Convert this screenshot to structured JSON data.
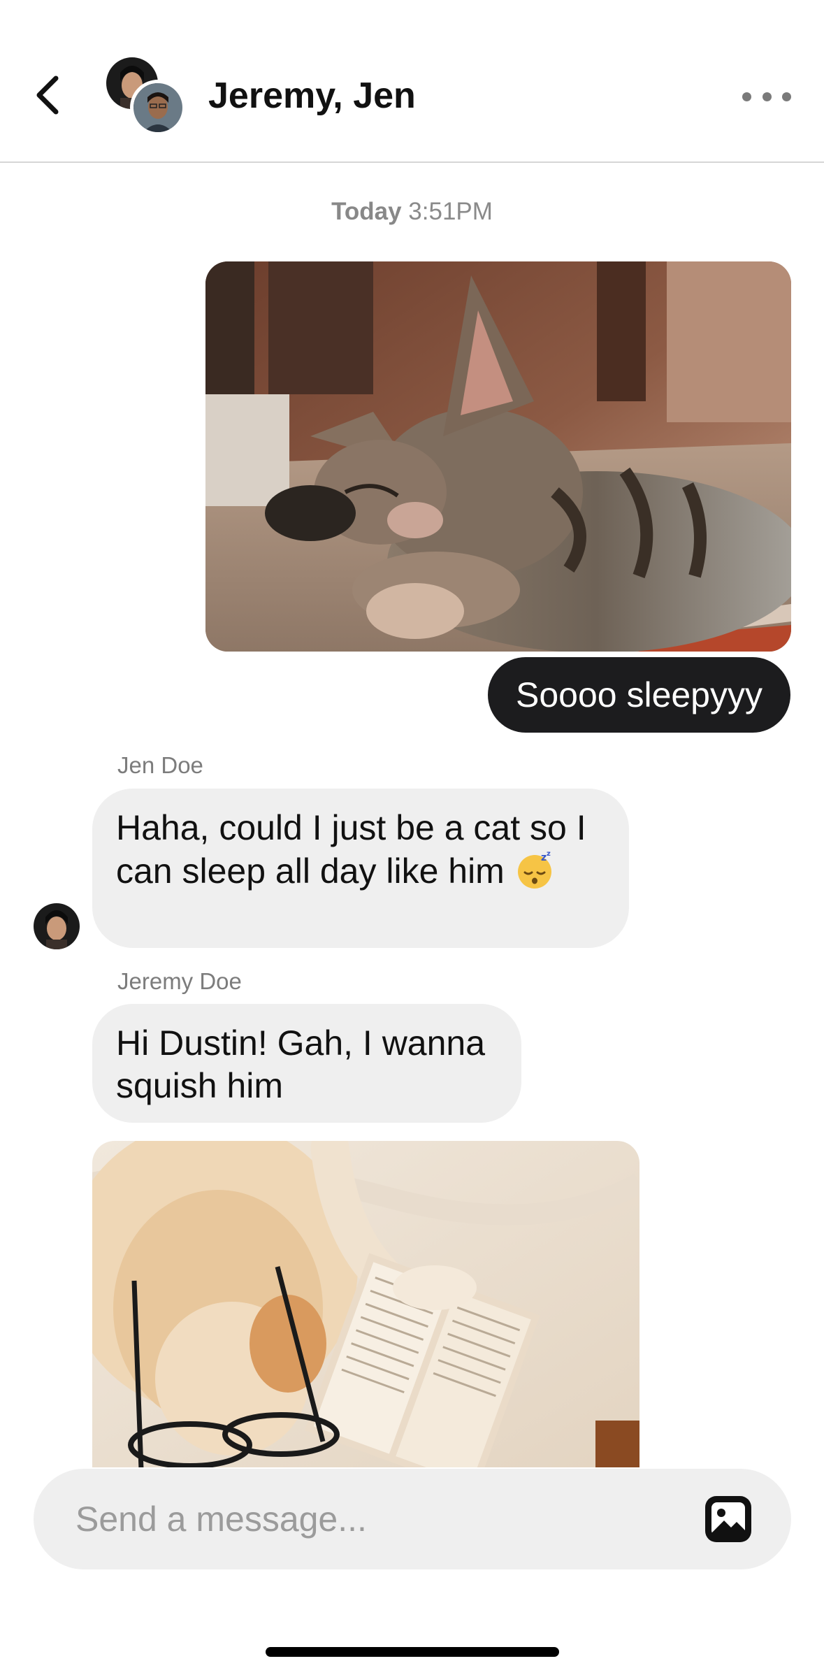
{
  "header": {
    "title": "Jeremy, Jen",
    "back_icon": "chevron-left-icon",
    "more_icon": "ellipsis-icon"
  },
  "conversation": {
    "timestamp": {
      "day": "Today",
      "time": "3:51PM"
    },
    "messages": [
      {
        "type": "photo",
        "direction": "outgoing",
        "subject": "sleeping kitten"
      },
      {
        "type": "text",
        "direction": "outgoing",
        "text": "Soooo sleepyyy"
      },
      {
        "type": "text",
        "direction": "incoming",
        "sender": "Jen Doe",
        "text": "Haha, could I just be a cat so I can sleep all day like him",
        "emoji": "sleeping-face-icon"
      },
      {
        "type": "text",
        "direction": "incoming",
        "sender": "Jeremy Doe",
        "text": "Hi Dustin! Gah, I wanna squish him"
      },
      {
        "type": "photo",
        "direction": "incoming",
        "subject": "dog sleeping with glasses and book"
      }
    ]
  },
  "composer": {
    "placeholder": "Send a message...",
    "image_icon": "image-icon"
  },
  "colors": {
    "outgoing_bubble": "#1c1c1e",
    "incoming_bubble": "#efefef",
    "secondary_text": "#7c7c7c"
  }
}
